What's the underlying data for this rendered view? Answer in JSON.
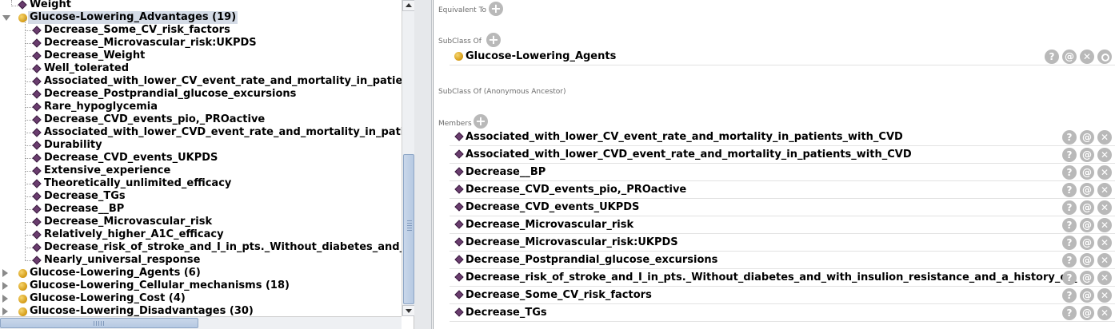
{
  "tree": {
    "top_item": "Weight",
    "selected": {
      "label": "Glucose-Lowering_Advantages (19)"
    },
    "children": [
      "Decrease_Some_CV_risk_factors",
      "Decrease_Microvascular_risk:UKPDS",
      "Decrease_Weight",
      "Well_tolerated",
      "Associated_with_lower_CV_event_rate_and_mortality_in_patients",
      "Decrease_Postprandial_glucose_excursions",
      "Rare_hypoglycemia",
      "Decrease_CVD_events_pio,_PROactive",
      "Associated_with_lower_CVD_event_rate_and_mortality_in_patien",
      "Durability",
      "Decrease_CVD_events_UKPDS",
      "Extensive_experience",
      "Theoretically_unlimited_efficacy",
      "Decrease_TGs",
      "Decrease__BP",
      "Decrease_Microvascular_risk",
      "Relatively_higher_A1C_efficacy",
      "Decrease_risk_of_stroke_and_I_in_pts._Without_diabetes_and_w",
      "Nearly_universal_response"
    ],
    "siblings": [
      "Glucose-Lowering_Agents (6)",
      "Glucose-Lowering_Cellular_mechanisms (18)",
      "Glucose-Lowering_Cost (4)",
      "Glucose-Lowering_Disadvantages (30)"
    ]
  },
  "description": {
    "equivalent_to_label": "Equivalent To",
    "subclass_of_label": "SubClass Of",
    "subclass_of_value": "Glucose-Lowering_Agents",
    "anonymous_ancestor_label": "SubClass Of (Anonymous Ancestor)",
    "members_label": "Members",
    "members": [
      "Associated_with_lower_CV_event_rate_and_mortality_in_patients_with_CVD",
      "Associated_with_lower_CVD_event_rate_and_mortality_in_patients_with_CVD",
      "Decrease__BP",
      "Decrease_CVD_events_pio,_PROactive",
      "Decrease_CVD_events_UKPDS",
      "Decrease_Microvascular_risk",
      "Decrease_Microvascular_risk:UKPDS",
      "Decrease_Postprandial_glucose_excursions",
      "Decrease_risk_of_stroke_and_I_in_pts._Without_diabetes_and_with_insulion_resistance_and_a_history_of_",
      "Decrease_Some_CV_risk_factors",
      "Decrease_TGs"
    ],
    "button_glyphs": {
      "add": "+",
      "help": "?",
      "annotate": "@",
      "delete": "✕"
    }
  },
  "icons": {
    "class": "class-ball-icon",
    "individual": "individual-diamond-icon",
    "colors": {
      "class_ball": "#d49a14",
      "individual_diamond": "#6a3d6e",
      "selection": "#d4dbe6"
    }
  }
}
